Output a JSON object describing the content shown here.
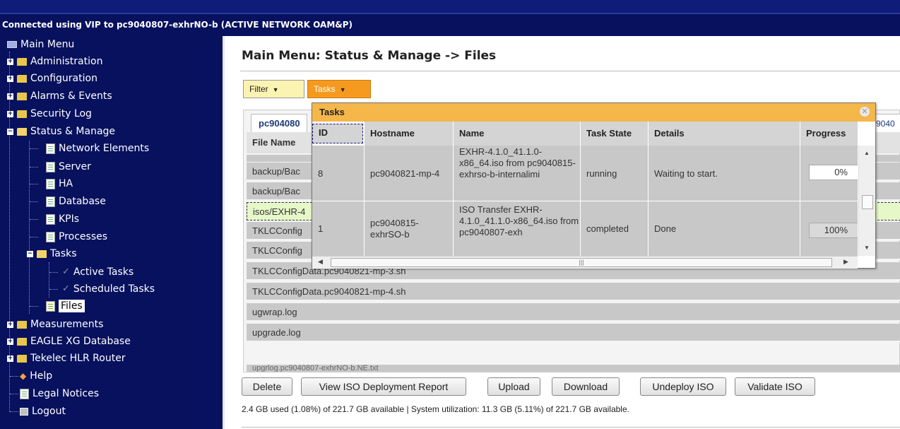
{
  "connection_banner": "Connected using VIP to pc9040807-exhrNO-b (ACTIVE NETWORK OAM&P)",
  "sidebar": {
    "items": [
      {
        "label": "Main Menu"
      },
      {
        "label": "Administration"
      },
      {
        "label": "Configuration"
      },
      {
        "label": "Alarms & Events"
      },
      {
        "label": "Security Log"
      },
      {
        "label": "Status & Manage"
      },
      {
        "label": "Network Elements"
      },
      {
        "label": "Server"
      },
      {
        "label": "HA"
      },
      {
        "label": "Database"
      },
      {
        "label": "KPIs"
      },
      {
        "label": "Processes"
      },
      {
        "label": "Tasks"
      },
      {
        "label": "Active Tasks"
      },
      {
        "label": "Scheduled Tasks"
      },
      {
        "label": "Files"
      },
      {
        "label": "Measurements"
      },
      {
        "label": "EAGLE XG Database"
      },
      {
        "label": "Tekelec HLR Router"
      },
      {
        "label": "Help"
      },
      {
        "label": "Legal Notices"
      },
      {
        "label": "Logout"
      }
    ]
  },
  "main": {
    "title": "Main Menu: Status & Manage -> Files",
    "filter_label": "Filter",
    "tasks_label": "Tasks",
    "tab_active": "pc904080",
    "tab_right": "9040",
    "files_header": "File Name",
    "files": [
      "backup/Bac",
      "backup/Bac",
      "isos/EXHR-4",
      "TKLCConfig",
      "TKLCConfig",
      "TKLCConfigData.pc9040821-mp-3.sh",
      "TKLCConfigData.pc9040821-mp-4.sh",
      "ugwrap.log",
      "upgrade.log",
      "upgrlog.pc9040807-exhrNO-b.NE.txt"
    ],
    "buttons": {
      "delete": "Delete",
      "view_iso": "View ISO Deployment Report",
      "upload": "Upload",
      "download": "Download",
      "undeploy": "Undeploy ISO",
      "validate": "Validate ISO"
    },
    "usage": "2.4 GB used (1.08%) of 221.7 GB available | System utilization: 11.3 GB (5.11%) of 221.7 GB available."
  },
  "tasks_popup": {
    "title": "Tasks",
    "columns": [
      "ID",
      "Hostname",
      "Name",
      "Task State",
      "Details",
      "Progress"
    ],
    "rows": [
      {
        "id": "8",
        "hostname": "pc9040821-mp-4",
        "name": "EXHR-4.1.0_41.1.0-x86_64.iso from pc9040815-exhrso-b-internalimi",
        "state": "running",
        "details": "Waiting to start.",
        "progress": "0%"
      },
      {
        "id": "1",
        "hostname": "pc9040815-exhrSO-b",
        "name": "ISO Transfer EXHR-4.1.0_41.1.0-x86_64.iso from pc9040807-exh",
        "state": "completed",
        "details": "Done",
        "progress": "100%"
      }
    ]
  }
}
